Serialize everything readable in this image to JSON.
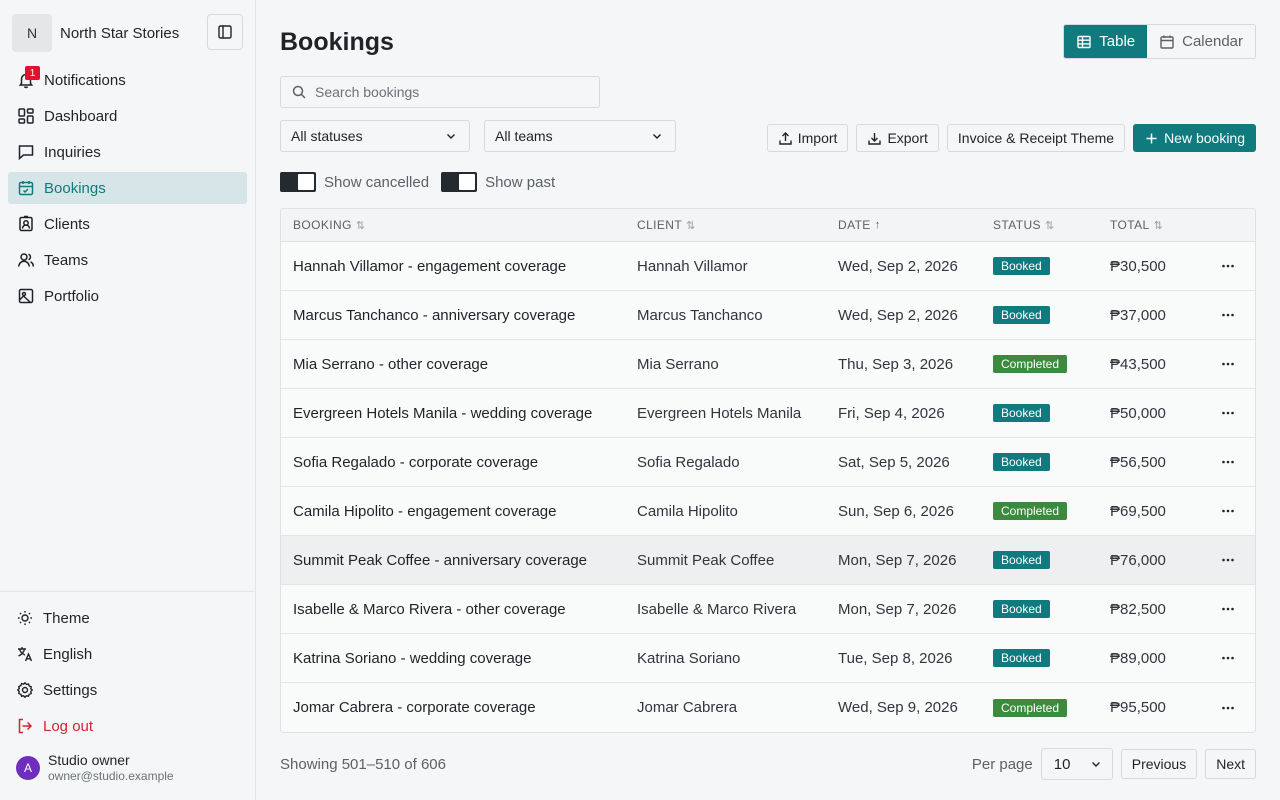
{
  "brand": {
    "initial": "N",
    "name": "North Star Stories"
  },
  "nav": {
    "items": [
      {
        "label": "Notifications",
        "icon": "bell-icon",
        "badge": "1"
      },
      {
        "label": "Dashboard",
        "icon": "dashboard-icon"
      },
      {
        "label": "Inquiries",
        "icon": "message-icon"
      },
      {
        "label": "Bookings",
        "icon": "calendar-icon",
        "active": true
      },
      {
        "label": "Clients",
        "icon": "contact-icon"
      },
      {
        "label": "Teams",
        "icon": "users-icon"
      },
      {
        "label": "Portfolio",
        "icon": "image-icon"
      }
    ]
  },
  "sidebar_bottom": {
    "theme": "Theme",
    "language": "English",
    "settings": "Settings",
    "logout": "Log out"
  },
  "user": {
    "initial": "A",
    "name": "Studio owner",
    "email": "owner@studio.example"
  },
  "page": {
    "title": "Bookings"
  },
  "view_toggle": {
    "table": "Table",
    "calendar": "Calendar"
  },
  "search": {
    "placeholder": "Search bookings",
    "value": ""
  },
  "filters": {
    "status": "All statuses",
    "team": "All teams"
  },
  "toolbar": {
    "import": "Import",
    "export": "Export",
    "theme": "Invoice & Receipt Theme",
    "new_booking": "New booking"
  },
  "toggles": {
    "show_cancelled": "Show cancelled",
    "show_past": "Show past"
  },
  "table": {
    "headers": {
      "booking": "BOOKING",
      "client": "CLIENT",
      "date": "DATE",
      "status": "STATUS",
      "total": "TOTAL"
    },
    "rows": [
      {
        "booking": "Hannah Villamor - engagement coverage",
        "client": "Hannah Villamor",
        "date": "Wed, Sep 2, 2026",
        "status": "Booked",
        "total": "₱30,500"
      },
      {
        "booking": "Marcus Tanchanco - anniversary coverage",
        "client": "Marcus Tanchanco",
        "date": "Wed, Sep 2, 2026",
        "status": "Booked",
        "total": "₱37,000"
      },
      {
        "booking": "Mia Serrano - other coverage",
        "client": "Mia Serrano",
        "date": "Thu, Sep 3, 2026",
        "status": "Completed",
        "total": "₱43,500"
      },
      {
        "booking": "Evergreen Hotels Manila - wedding coverage",
        "client": "Evergreen Hotels Manila",
        "date": "Fri, Sep 4, 2026",
        "status": "Booked",
        "total": "₱50,000"
      },
      {
        "booking": "Sofia Regalado - corporate coverage",
        "client": "Sofia Regalado",
        "date": "Sat, Sep 5, 2026",
        "status": "Booked",
        "total": "₱56,500"
      },
      {
        "booking": "Camila Hipolito - engagement coverage",
        "client": "Camila Hipolito",
        "date": "Sun, Sep 6, 2026",
        "status": "Completed",
        "total": "₱69,500"
      },
      {
        "booking": "Summit Peak Coffee - anniversary coverage",
        "client": "Summit Peak Coffee",
        "date": "Mon, Sep 7, 2026",
        "status": "Booked",
        "total": "₱76,000"
      },
      {
        "booking": "Isabelle & Marco Rivera - other coverage",
        "client": "Isabelle & Marco Rivera",
        "date": "Mon, Sep 7, 2026",
        "status": "Booked",
        "total": "₱82,500"
      },
      {
        "booking": "Katrina Soriano - wedding coverage",
        "client": "Katrina Soriano",
        "date": "Tue, Sep 8, 2026",
        "status": "Booked",
        "total": "₱89,000"
      },
      {
        "booking": "Jomar Cabrera - corporate coverage",
        "client": "Jomar Cabrera",
        "date": "Wed, Sep 9, 2026",
        "status": "Completed",
        "total": "₱95,500"
      }
    ]
  },
  "pagination": {
    "showing": "Showing 501–510 of 606",
    "per_page_label": "Per page",
    "per_page_value": "10",
    "previous": "Previous",
    "next": "Next"
  },
  "colors": {
    "accent": "#117a7e",
    "completed": "#3c8a3e",
    "danger": "#d1242f",
    "badge_red": "#e0122d"
  }
}
